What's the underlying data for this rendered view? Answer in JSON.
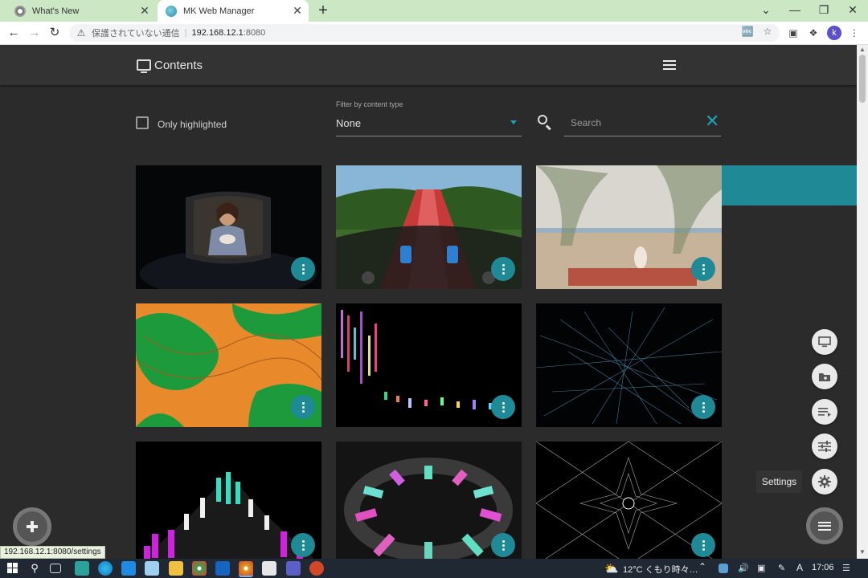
{
  "browser": {
    "tabs": [
      {
        "label": "What's New",
        "close": "✕"
      },
      {
        "label": "MK Web Manager",
        "close": "✕"
      }
    ],
    "new_tab": "+",
    "window_controls": {
      "minimize": "—",
      "maximize": "❐",
      "close": "✕",
      "tabs_menu": "⌄"
    },
    "address": {
      "security_label": "保護されていない通信",
      "separator": "|",
      "host": "192.168.12.1",
      "port": ":8080"
    },
    "status_url": "192.168.12.1:8080/settings"
  },
  "app": {
    "title": "Contents",
    "filters": {
      "only_highlighted_label": "Only highlighted",
      "content_type_label": "Filter by content type",
      "content_type_value": "None",
      "search_placeholder": "Search"
    },
    "tooltip": "Settings"
  },
  "colors": {
    "accent": "#1f8a96",
    "accent_light": "#1fa3b3",
    "background": "#2b2b2b",
    "appbar": "#333333",
    "tabbar": "#cbe7c4"
  },
  "taskbar": {
    "weather": "12°C  くもり時々…",
    "ime": "A",
    "clock": "17:06"
  }
}
